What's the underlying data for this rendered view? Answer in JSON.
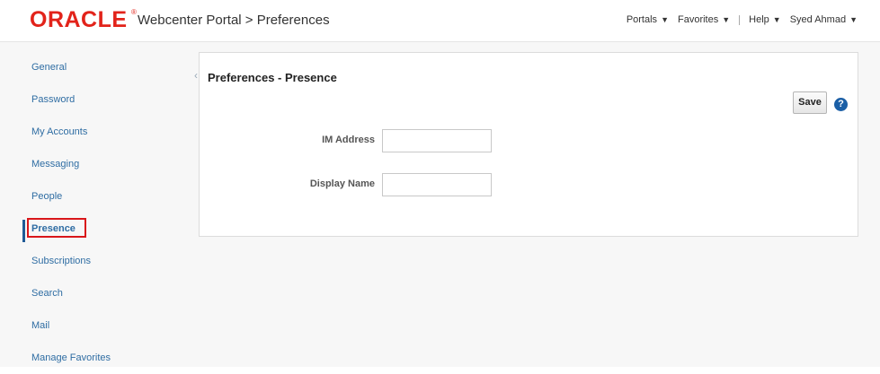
{
  "header": {
    "logo_text": "ORACLE",
    "logo_reg": "®",
    "app_title": "Webcenter Portal > Preferences",
    "menu": {
      "portals": "Portals",
      "favorites": "Favorites",
      "help": "Help",
      "user": "Syed Ahmad"
    },
    "caret": "▼"
  },
  "sidebar": {
    "items": [
      {
        "label": "General"
      },
      {
        "label": "Password"
      },
      {
        "label": "My Accounts"
      },
      {
        "label": "Messaging"
      },
      {
        "label": "People"
      },
      {
        "label": "Presence",
        "active": true
      },
      {
        "label": "Subscriptions"
      },
      {
        "label": "Search"
      },
      {
        "label": "Mail"
      },
      {
        "label": "Manage Favorites"
      }
    ]
  },
  "panel": {
    "title": "Preferences - Presence",
    "save_label": "Save",
    "help_glyph": "?",
    "fields": [
      {
        "label": "IM Address",
        "value": "",
        "placeholder": ""
      },
      {
        "label": "Display Name",
        "value": "",
        "placeholder": ""
      }
    ]
  },
  "colors": {
    "brand": "#e2231a",
    "link": "#2f6da3",
    "active_marker": "#1f5a96",
    "highlight_box": "#d9161a",
    "help_icon": "#1b5fa6"
  },
  "icons": {
    "collapse": "chevron-left-icon",
    "help": "help-icon",
    "dropdown": "caret-down-icon"
  }
}
